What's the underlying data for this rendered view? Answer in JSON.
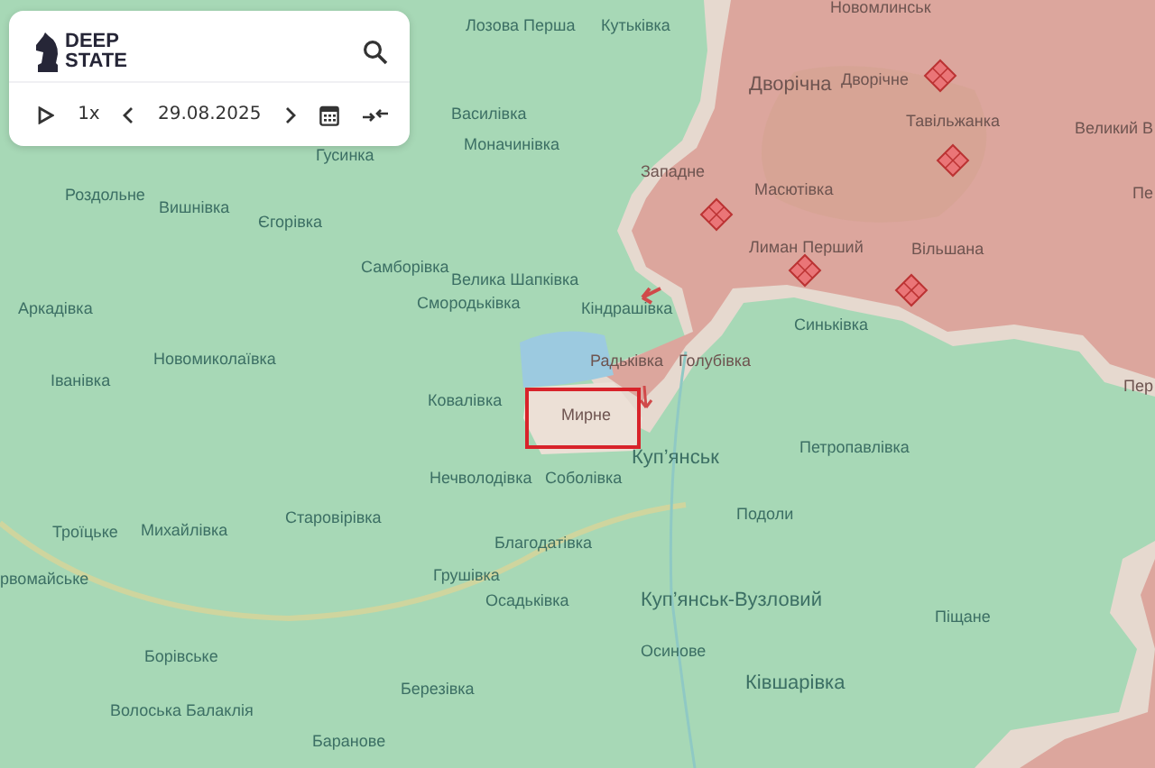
{
  "panel": {
    "logo_lines": [
      "DEEP",
      "STATE"
    ],
    "speed": "1x",
    "date": "29.08.2025"
  },
  "map": {
    "labels": [
      {
        "text": "Новомлинськ",
        "kind": "village",
        "occupied": true
      },
      {
        "text": "Лозова Перша",
        "kind": "village",
        "occupied": false
      },
      {
        "text": "Кутьківка",
        "kind": "village",
        "occupied": false
      },
      {
        "text": "Дворічна",
        "kind": "city",
        "occupied": true
      },
      {
        "text": "Дворічне",
        "kind": "village",
        "occupied": true
      },
      {
        "text": "Василівка",
        "kind": "village",
        "occupied": false
      },
      {
        "text": "Тавільжанка",
        "kind": "village",
        "occupied": true
      },
      {
        "text": "Великий В",
        "kind": "village",
        "occupied": true
      },
      {
        "text": "Моначинівка",
        "kind": "village",
        "occupied": false
      },
      {
        "text": "Гусинка",
        "kind": "village",
        "occupied": false
      },
      {
        "text": "Западне",
        "kind": "village",
        "occupied": true
      },
      {
        "text": "Роздольне",
        "kind": "village",
        "occupied": false
      },
      {
        "text": "Масютівка",
        "kind": "village",
        "occupied": true
      },
      {
        "text": "Пе",
        "kind": "village",
        "occupied": true
      },
      {
        "text": "Вишнівка",
        "kind": "village",
        "occupied": false
      },
      {
        "text": "Єгорівка",
        "kind": "village",
        "occupied": false
      },
      {
        "text": "Лиман Перший",
        "kind": "village",
        "occupied": true
      },
      {
        "text": "Вільшана",
        "kind": "village",
        "occupied": true
      },
      {
        "text": "Самборівка",
        "kind": "village",
        "occupied": false
      },
      {
        "text": "Велика Шапківка",
        "kind": "village",
        "occupied": false
      },
      {
        "text": "Аркадівка",
        "kind": "village",
        "occupied": false
      },
      {
        "text": "Смородьківка",
        "kind": "village",
        "occupied": false
      },
      {
        "text": "Кіндрашівка",
        "kind": "village",
        "occupied": false
      },
      {
        "text": "Синьківка",
        "kind": "village",
        "occupied": false
      },
      {
        "text": "Новомиколаївка",
        "kind": "village",
        "occupied": false
      },
      {
        "text": "Радьківка",
        "kind": "village",
        "occupied": true
      },
      {
        "text": "Голубівка",
        "kind": "village",
        "occupied": true
      },
      {
        "text": "Іванівка",
        "kind": "village",
        "occupied": false
      },
      {
        "text": "Пер",
        "kind": "village",
        "occupied": true
      },
      {
        "text": "Ковалівка",
        "kind": "village",
        "occupied": false
      },
      {
        "text": "Мирне",
        "kind": "village",
        "occupied": true
      },
      {
        "text": "Петропавлівка",
        "kind": "village",
        "occupied": false
      },
      {
        "text": "Куп’янськ",
        "kind": "city",
        "occupied": false
      },
      {
        "text": "Нечволодівка",
        "kind": "village",
        "occupied": false
      },
      {
        "text": "Соболівка",
        "kind": "village",
        "occupied": false
      },
      {
        "text": "Старовірівка",
        "kind": "village",
        "occupied": false
      },
      {
        "text": "Подоли",
        "kind": "village",
        "occupied": false
      },
      {
        "text": "Троїцьке",
        "kind": "village",
        "occupied": false
      },
      {
        "text": "Михайлівка",
        "kind": "village",
        "occupied": false
      },
      {
        "text": "Благодатівка",
        "kind": "village",
        "occupied": false
      },
      {
        "text": "рвомайське",
        "kind": "village",
        "occupied": false
      },
      {
        "text": "Грушівка",
        "kind": "village",
        "occupied": false
      },
      {
        "text": "Осадьківка",
        "kind": "village",
        "occupied": false
      },
      {
        "text": "Куп’янськ-Вузловий",
        "kind": "city",
        "occupied": false
      },
      {
        "text": "Піщане",
        "kind": "village",
        "occupied": false
      },
      {
        "text": "Борівське",
        "kind": "village",
        "occupied": false
      },
      {
        "text": "Осинове",
        "kind": "village",
        "occupied": false
      },
      {
        "text": "Березівка",
        "kind": "village",
        "occupied": false
      },
      {
        "text": "Ківшарівка",
        "kind": "city",
        "occupied": false
      },
      {
        "text": "Волоська Балаклія",
        "kind": "village",
        "occupied": false
      },
      {
        "text": "Баранове",
        "kind": "village",
        "occupied": false
      }
    ]
  }
}
